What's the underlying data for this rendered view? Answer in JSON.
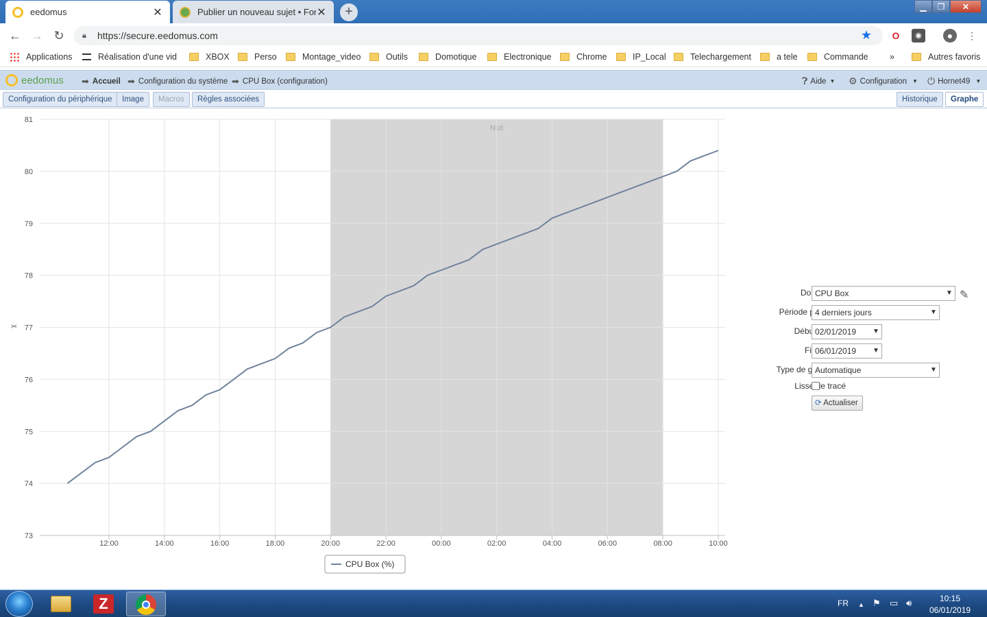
{
  "browser": {
    "tabs": [
      {
        "label": "eedomus",
        "active": true
      },
      {
        "label": "Publier un nouveau sujet • Forum",
        "active": false
      }
    ],
    "address": "https://secure.eedomus.com",
    "bookmarks": {
      "apps": "Applications",
      "items": [
        "Réalisation d'une vid",
        "XBOX",
        "Perso",
        "Montage_video",
        "Outils",
        "Domotique",
        "Electronique",
        "Chrome",
        "IP_Local",
        "Telechargement",
        "a tele",
        "Commande"
      ],
      "more": "»",
      "other": "Autres favoris"
    }
  },
  "app": {
    "logo": "eedomus",
    "breadcrumb": [
      "Accueil",
      "Configuration du système",
      "CPU Box (configuration)"
    ],
    "menu": {
      "help": "Aide",
      "config": "Configuration",
      "user": "Hornet49"
    },
    "subtabs_left": [
      "Configuration du périphérique",
      "Image",
      "Macros",
      "Règles associées"
    ],
    "subtabs_right": [
      "Historique",
      "Graphe"
    ]
  },
  "chart_data": {
    "type": "line",
    "series": [
      {
        "name": "CPU Box (%)",
        "color": "#70829c",
        "x": [
          10.5,
          11.5,
          12,
          12.5,
          13,
          13.5,
          14,
          14.5,
          15,
          15.5,
          16,
          16.5,
          17,
          17.5,
          18,
          18.5,
          19,
          19.5,
          20,
          20.5,
          21,
          21.5,
          22,
          22.5,
          23,
          23.5,
          24,
          24.5,
          25,
          25.5,
          26,
          26.5,
          27,
          27.5,
          28,
          28.5,
          29,
          29.5,
          30,
          30.5,
          31,
          31.5,
          32,
          32.5,
          33,
          33.5,
          34
        ],
        "values": [
          74.0,
          74.4,
          74.5,
          74.7,
          74.9,
          75.0,
          75.2,
          75.4,
          75.5,
          75.7,
          75.8,
          76.0,
          76.2,
          76.3,
          76.4,
          76.6,
          76.7,
          76.9,
          77.0,
          77.2,
          77.3,
          77.4,
          77.6,
          77.7,
          77.8,
          78.0,
          78.1,
          78.2,
          78.3,
          78.5,
          78.6,
          78.7,
          78.8,
          78.9,
          79.1,
          79.2,
          79.3,
          79.4,
          79.5,
          79.6,
          79.7,
          79.8,
          79.9,
          80.0,
          80.2,
          80.3,
          80.4
        ]
      }
    ],
    "xlim": [
      9.5,
      34.25
    ],
    "ylim": [
      73,
      81
    ],
    "yticks": [
      "73",
      "74",
      "75",
      "76",
      "77",
      "78",
      "79",
      "80",
      "81"
    ],
    "xticks": [
      {
        "label": "12:00",
        "x": 12
      },
      {
        "label": "14:00",
        "x": 14
      },
      {
        "label": "16:00",
        "x": 16
      },
      {
        "label": "18:00",
        "x": 18
      },
      {
        "label": "20:00",
        "x": 20
      },
      {
        "label": "22:00",
        "x": 22
      },
      {
        "label": "00:00",
        "x": 24
      },
      {
        "label": "02:00",
        "x": 26
      },
      {
        "label": "04:00",
        "x": 28
      },
      {
        "label": "06:00",
        "x": 30
      },
      {
        "label": "08:00",
        "x": 32
      },
      {
        "label": "10:00",
        "x": 34
      }
    ],
    "band": {
      "label": "Nuit",
      "from": 20,
      "to": 32
    },
    "grid": true,
    "legend": "bottom"
  },
  "form": {
    "donnees": {
      "label": "Données",
      "value": "CPU Box"
    },
    "periode": {
      "label": "Période prédéfinie",
      "value": "4 derniers jours"
    },
    "debut": {
      "label": "Début période",
      "value": "02/01/2019"
    },
    "fin": {
      "label": "Fin période",
      "value": "06/01/2019"
    },
    "type": {
      "label": "Type de graphe",
      "value": "Automatique"
    },
    "lisser": {
      "label": "Lisser le tracé",
      "checked": false
    },
    "refresh": "Actualiser"
  },
  "taskbar": {
    "lang": "FR",
    "time": "10:15",
    "date": "06/01/2019"
  }
}
